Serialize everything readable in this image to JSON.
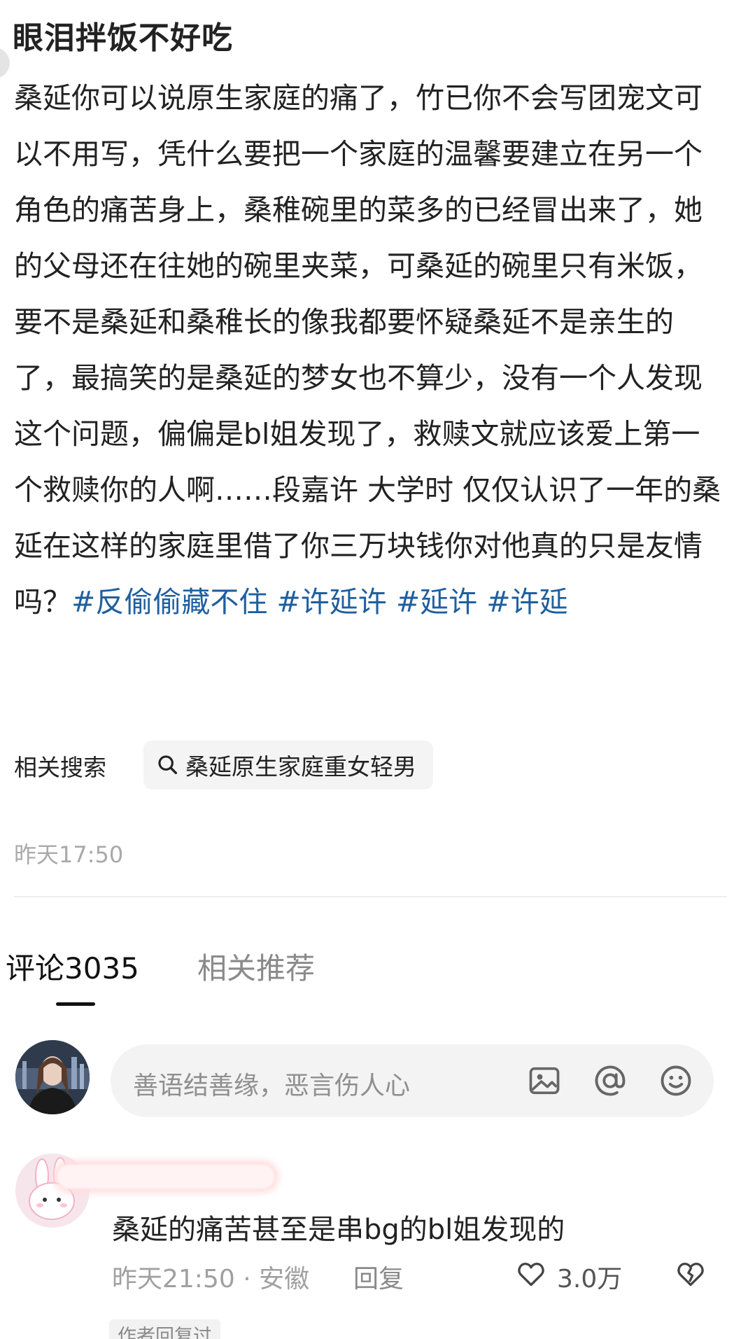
{
  "post": {
    "title": "眼泪拌饭不好吃",
    "body": "桑延你可以说原生家庭的痛了，竹已你不会写团宠文可以不用写，凭什么要把一个家庭的温馨要建立在另一个角色的痛苦身上，桑稚碗里的菜多的已经冒出来了，她的父母还在往她的碗里夹菜，可桑延的碗里只有米饭，要不是桑延和桑稚长的像我都要怀疑桑延不是亲生的了，最搞笑的是桑延的梦女也不算少，没有一个人发现这个问题，偏偏是bl姐发现了，救赎文就应该爱上第一个救赎你的人啊……段嘉许 大学时 仅仅认识了一年的桑延在这样的家庭里借了你三万块钱你对他真的只是友情吗？",
    "hashtags": [
      "#反偷偷藏不住",
      "#许延许",
      "#延许",
      "#许延"
    ],
    "related_label": "相关搜索",
    "related_query": "桑延原生家庭重女轻男",
    "time": "昨天17:50"
  },
  "tabs": {
    "comments": "评论3035",
    "related": "相关推荐"
  },
  "comment_input": {
    "placeholder": "善语结善缘，恶言伤人心"
  },
  "comment": {
    "text": "桑延的痛苦甚至是串bg的bl姐发现的",
    "meta": "昨天21:50 · 安徽",
    "reply_label": "回复",
    "likes": "3.0万",
    "badge": "作者回复过"
  },
  "icons": {
    "search": "search-icon",
    "image": "image-icon",
    "at": "at-icon",
    "emoji": "emoji-icon",
    "like": "heart-icon",
    "dislike": "broken-heart-icon"
  },
  "colors": {
    "hashtag": "#1f5f9f",
    "text": "#222222",
    "muted": "#a0a0a0"
  }
}
